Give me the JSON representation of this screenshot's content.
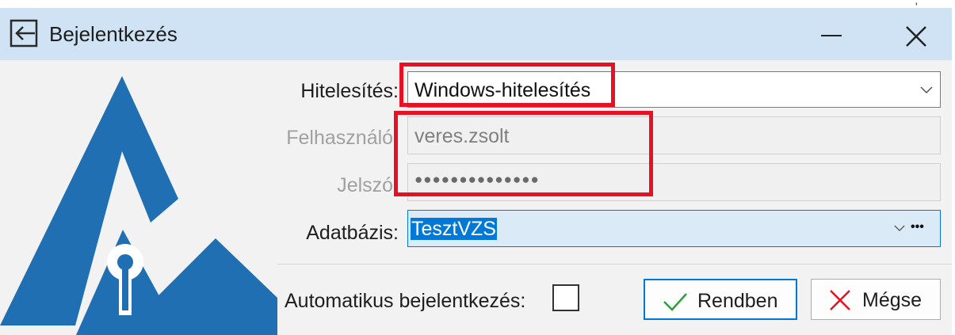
{
  "window": {
    "title": "Bejelentkezés",
    "icon": "login-arrow-icon",
    "edge_mark": "'"
  },
  "form": {
    "auth": {
      "label": "Hitelesítés:",
      "value": "Windows-hitelesítés"
    },
    "user": {
      "label": "Felhasználó:",
      "value": "veres.zsolt"
    },
    "password": {
      "label": "Jelszó:",
      "value": "●●●●●●●●●●●●●●"
    },
    "database": {
      "label": "Adatbázis:",
      "value": "TesztVZS",
      "more": "•••"
    },
    "autologin": {
      "label": "Automatikus bejelentkezés:",
      "checked": false
    }
  },
  "buttons": {
    "ok": "Rendben",
    "cancel": "Mégse"
  },
  "colors": {
    "titlebar": "#cfe3f5",
    "accent": "#0078d7",
    "logo": "#1f6fb2",
    "highlight": "#e81123",
    "ok_check": "#2e9e3f",
    "cancel_x": "#e81123"
  }
}
